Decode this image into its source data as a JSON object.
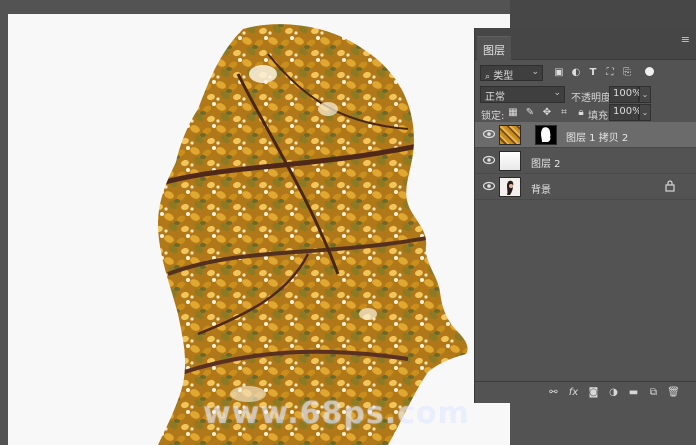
{
  "panel": {
    "tab_label": "图层",
    "collapse_icon": "collapse-icon",
    "close_icon": "close-icon",
    "menu_icon": "panel-menu-icon"
  },
  "filter": {
    "kind_label": "类型",
    "icons": [
      "image-filter-icon",
      "adjustment-filter-icon",
      "text-filter-icon",
      "shape-filter-icon",
      "smart-object-filter-icon"
    ]
  },
  "blend": {
    "mode": "正常",
    "opacity_label": "不透明度:",
    "opacity_value": "100%"
  },
  "lock": {
    "label": "锁定:",
    "fill_label": "填充:",
    "fill_value": "100%"
  },
  "layers": [
    {
      "name": "图层 1 拷贝 2",
      "selected": true,
      "has_mask": true
    },
    {
      "name": "图层 2",
      "selected": false,
      "has_mask": false
    },
    {
      "name": "背景",
      "selected": false,
      "has_mask": false,
      "locked": true
    }
  ],
  "footer_icons": [
    "link-layers-icon",
    "fx-icon",
    "add-mask-icon",
    "new-adjustment-icon",
    "new-group-icon",
    "new-layer-icon",
    "delete-layer-icon"
  ],
  "canvas": {
    "watermark": "www.68ps.com"
  },
  "colors": {
    "panel_bg": "#535353",
    "selected_row": "#6b6b6b",
    "leaf_gold": "#c9901a",
    "branch": "#5a3020"
  }
}
